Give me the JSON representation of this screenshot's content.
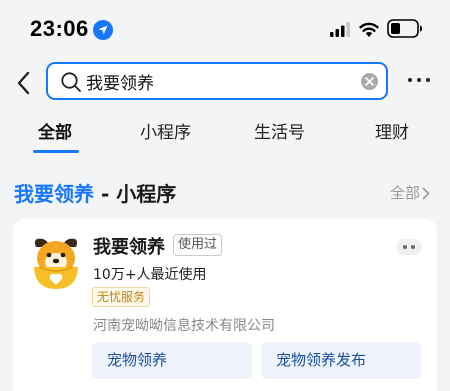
{
  "status_bar": {
    "time": "23:06",
    "icons": [
      "location-arrow-icon",
      "cellular-signal-icon",
      "wifi-icon",
      "battery-icon"
    ]
  },
  "search": {
    "query": "我要领养",
    "icons": [
      "back-chevron-icon",
      "search-icon",
      "clear-icon",
      "more-icon"
    ]
  },
  "tabs": [
    {
      "label": "全部",
      "active": true
    },
    {
      "label": "小程序",
      "active": false
    },
    {
      "label": "生活号",
      "active": false
    },
    {
      "label": "理财",
      "active": false
    }
  ],
  "section": {
    "title_highlight": "我要领养",
    "title_suffix": " - 小程序",
    "see_all": "全部"
  },
  "result": {
    "name": "我要领养",
    "used_badge": "使用过",
    "user_count": "10万+人最近使用",
    "service_badge": "无忧服务",
    "company": "河南宠呦呦信息技术有限公司",
    "services": [
      "宠物领养",
      "宠物领养发布"
    ]
  },
  "colors": {
    "accent": "#1677ff",
    "background": "#f3f4f6",
    "badge_gold": "#b8860b",
    "button_bg": "#eef3fb"
  }
}
